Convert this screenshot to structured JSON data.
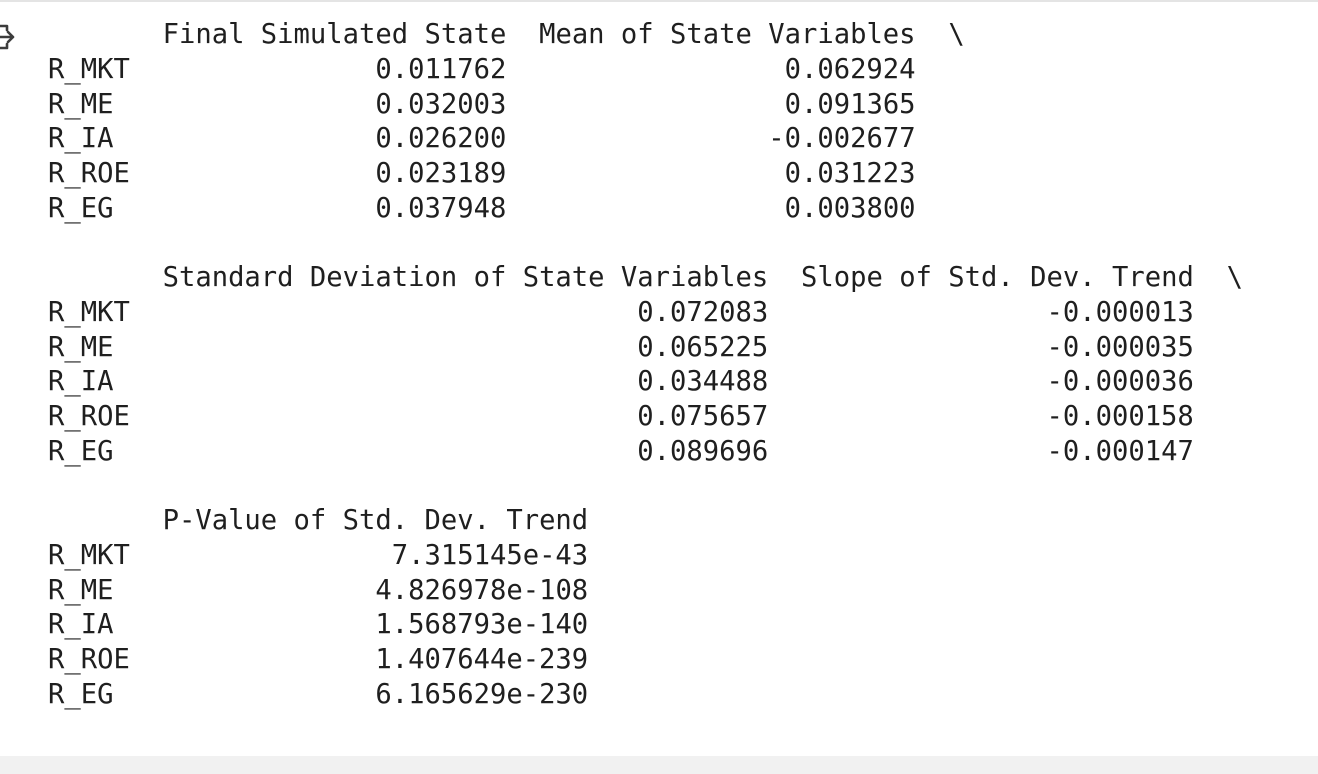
{
  "row_labels": [
    "R_MKT",
    "R_ME",
    "R_IA",
    "R_ROE",
    "R_EG"
  ],
  "continuation_marker": "\\",
  "tables": [
    {
      "columns": [
        {
          "header": "Final Simulated State",
          "values": [
            "0.011762",
            "0.032003",
            "0.026200",
            "0.023189",
            "0.037948"
          ]
        },
        {
          "header": "Mean of State Variables",
          "values": [
            "0.062924",
            "0.091365",
            "-0.002677",
            "0.031223",
            "0.003800"
          ]
        }
      ],
      "continued": true
    },
    {
      "columns": [
        {
          "header": "Standard Deviation of State Variables",
          "values": [
            "0.072083",
            "0.065225",
            "0.034488",
            "0.075657",
            "0.089696"
          ]
        },
        {
          "header": "Slope of Std. Dev. Trend",
          "values": [
            "-0.000013",
            "-0.000035",
            "-0.000036",
            "-0.000158",
            "-0.000147"
          ]
        }
      ],
      "continued": true
    },
    {
      "columns": [
        {
          "header": "P-Value of Std. Dev. Trend",
          "values": [
            "7.315145e-43",
            "4.826978e-108",
            "1.568793e-140",
            "1.407644e-239",
            "6.165629e-230"
          ]
        }
      ],
      "continued": false
    }
  ],
  "icons": {
    "output_icon": "output-redirect-icon"
  }
}
